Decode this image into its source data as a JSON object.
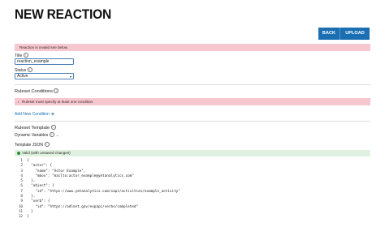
{
  "header": {
    "title": "NEW REACTION"
  },
  "toolbar": {
    "back_label": "BACK",
    "upload_label": "UPLOAD"
  },
  "alerts": {
    "invalid": "Reaction is invalid see below.",
    "ruleset_error": "Ruleset must specify at least one condition."
  },
  "form": {
    "title_label": "Title",
    "title_value": "reaction_example",
    "status_label": "Status",
    "status_value": "Active"
  },
  "ruleset_conditions": {
    "heading": "Ruleset Conditions",
    "add_label": "Add New Condition"
  },
  "ruleset_template": {
    "heading": "Ruleset Template",
    "dynamic_variables_label": "Dynamic Variables",
    "template_json_label": "Template JSON",
    "valid_text": "Valid (with unsaved changes)"
  },
  "code": {
    "lines": [
      {
        "n": "1",
        "text": "{"
      },
      {
        "n": "2",
        "text": "  \"actor\": {"
      },
      {
        "n": "3",
        "text": "    \"name\": \"Actor Example\","
      },
      {
        "n": "4",
        "text": "    \"mbox\": \"mailto:actor_example@yetanalytics.com\""
      },
      {
        "n": "5",
        "text": "  },"
      },
      {
        "n": "6",
        "text": "  \"object\": {"
      },
      {
        "n": "7",
        "text": "    \"id\": \"https://www.yetanalytics.com/xapi/activities/example_activity\""
      },
      {
        "n": "8",
        "text": "  },"
      },
      {
        "n": "9",
        "text": "  \"verb\": {"
      },
      {
        "n": "10",
        "text": "    \"id\": \"https://adlnet.gov/expapi/verbs/completed\""
      },
      {
        "n": "11",
        "text": "  }"
      },
      {
        "n": "12",
        "text": "}"
      }
    ]
  },
  "colors": {
    "primary": "#1a6fb3",
    "error_bg": "#f7c7d0",
    "valid_bg": "#dff2df",
    "valid_icon": "#2e8b3a"
  },
  "icons": {
    "help": "info-circle-icon",
    "add": "plus-icon",
    "chevron": "chevron-down-icon",
    "check": "check-circle-icon"
  }
}
